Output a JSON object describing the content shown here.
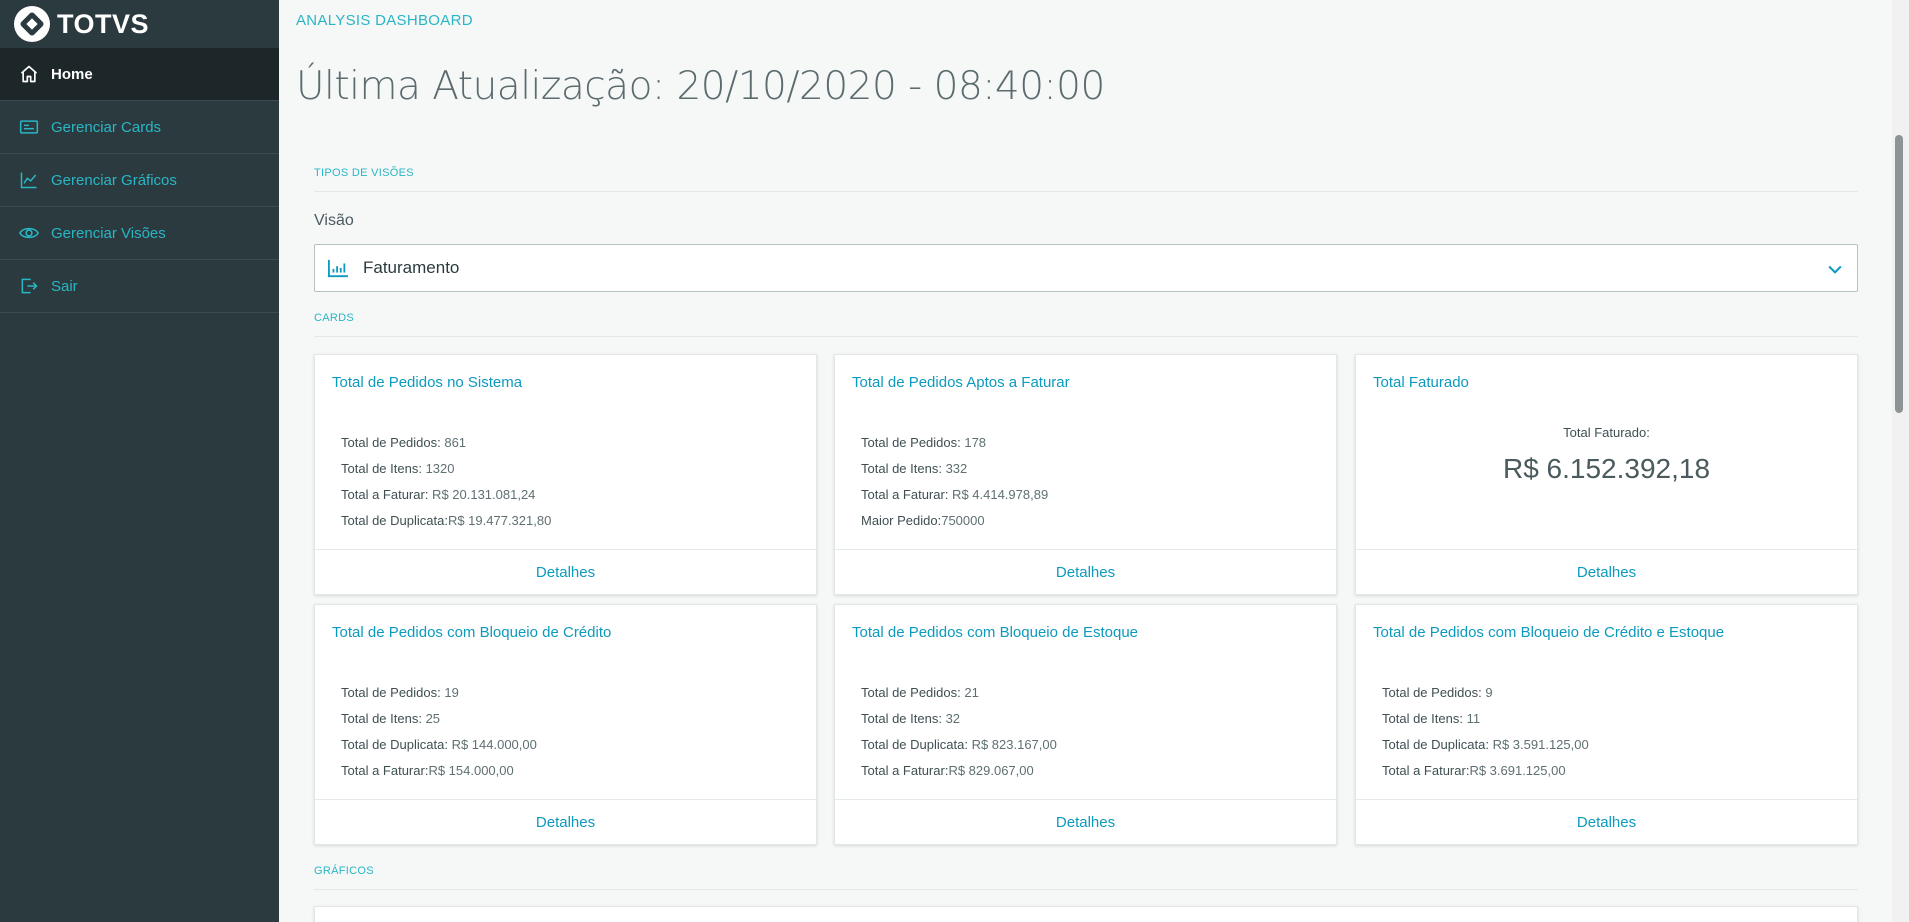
{
  "brand": {
    "name": "TOTVS"
  },
  "sidebar": {
    "items": [
      {
        "label": "Home",
        "icon": "home-icon",
        "active": true
      },
      {
        "label": "Gerenciar Cards",
        "icon": "card-icon"
      },
      {
        "label": "Gerenciar Gráficos",
        "icon": "chart-line-icon"
      },
      {
        "label": "Gerenciar Visões",
        "icon": "eye-icon"
      },
      {
        "label": "Sair",
        "icon": "exit-icon"
      }
    ]
  },
  "header": {
    "breadcrumb": "ANALYSIS DASHBOARD",
    "title": "Última Atualização: 20/10/2020 - 08:40:00"
  },
  "sections": {
    "tipos_visoes": "TIPOS DE VISÕES",
    "cards": "CARDS",
    "graficos": "GRÁFICOS"
  },
  "visao": {
    "label": "Visão",
    "selected": "Faturamento"
  },
  "cards": [
    {
      "title": "Total de Pedidos no Sistema",
      "lines": [
        {
          "key": "Total de Pedidos:",
          "value": " 861"
        },
        {
          "key": "Total de Itens:",
          "value": " 1320"
        },
        {
          "key": "Total a Faturar:",
          "value": " R$ 20.131.081,24"
        },
        {
          "key": "Total de Duplicata:",
          "value": "R$ 19.477.321,80"
        }
      ],
      "footer": "Detalhes"
    },
    {
      "title": "Total de Pedidos Aptos a Faturar",
      "lines": [
        {
          "key": "Total de Pedidos:",
          "value": " 178"
        },
        {
          "key": "Total de Itens:",
          "value": " 332"
        },
        {
          "key": "Total a Faturar:",
          "value": " R$ 4.414.978,89"
        },
        {
          "key": "Maior Pedido:",
          "value": "750000"
        }
      ],
      "footer": "Detalhes"
    },
    {
      "title": "Total Faturado",
      "big_label": "Total Faturado:",
      "big_value": "R$ 6.152.392,18",
      "footer": "Detalhes"
    },
    {
      "title": "Total de Pedidos com Bloqueio de Crédito",
      "lines": [
        {
          "key": "Total de Pedidos:",
          "value": " 19"
        },
        {
          "key": "Total de Itens:",
          "value": " 25"
        },
        {
          "key": "Total de Duplicata:",
          "value": " R$ 144.000,00"
        },
        {
          "key": "Total a Faturar:",
          "value": "R$ 154.000,00"
        }
      ],
      "footer": "Detalhes"
    },
    {
      "title": "Total de Pedidos com Bloqueio de Estoque",
      "lines": [
        {
          "key": "Total de Pedidos:",
          "value": " 21"
        },
        {
          "key": "Total de Itens:",
          "value": " 32"
        },
        {
          "key": "Total de Duplicata:",
          "value": " R$ 823.167,00"
        },
        {
          "key": "Total a Faturar:",
          "value": "R$ 829.067,00"
        }
      ],
      "footer": "Detalhes"
    },
    {
      "title": "Total de Pedidos com Bloqueio de Crédito e Estoque",
      "lines": [
        {
          "key": "Total de Pedidos:",
          "value": " 9"
        },
        {
          "key": "Total de Itens:",
          "value": " 11"
        },
        {
          "key": "Total de Duplicata:",
          "value": " R$ 3.591.125,00"
        },
        {
          "key": "Total a Faturar:",
          "value": "R$ 3.691.125,00"
        }
      ],
      "footer": "Detalhes"
    }
  ],
  "colors": {
    "sidebar_bg": "#2b3a3e",
    "accent": "#29b6c5",
    "link": "#0c9abe"
  }
}
